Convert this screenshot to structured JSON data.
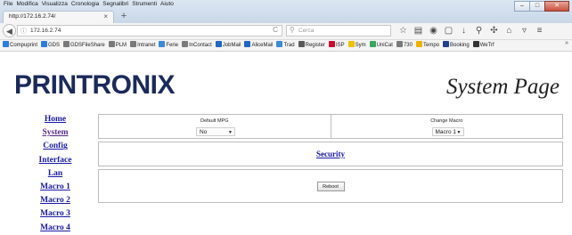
{
  "browser": {
    "menu": [
      "File",
      "Modifica",
      "Visualizza",
      "Cronologia",
      "Segnalibri",
      "Strumenti",
      "Aiuto"
    ],
    "window_controls": [
      "–",
      "□",
      "✕"
    ],
    "tab": {
      "title": "http://172.16.2.74/",
      "close": "×"
    },
    "new_tab": "+",
    "address": {
      "url": "172.16.2.74",
      "info_icon": "ⓘ",
      "reload_icon": "C"
    },
    "search": {
      "placeholder": "Cerca",
      "icon": "⚲"
    },
    "toolbar_icons": [
      {
        "name": "star-icon",
        "glyph": "☆"
      },
      {
        "name": "library-icon",
        "glyph": "▤"
      },
      {
        "name": "pocket-icon",
        "glyph": "◉"
      },
      {
        "name": "screenshot-icon",
        "glyph": "▢"
      },
      {
        "name": "download-icon",
        "glyph": "↓"
      },
      {
        "name": "addon-icon",
        "glyph": "⚲"
      },
      {
        "name": "extension-icon",
        "glyph": "✣"
      },
      {
        "name": "home-icon",
        "glyph": "⌂"
      },
      {
        "name": "shield-icon",
        "glyph": "▿"
      },
      {
        "name": "hamburger-menu-icon",
        "glyph": "≡"
      }
    ],
    "bookmarks": [
      {
        "label": "Compuprint",
        "color": "#2b7de0"
      },
      {
        "label": "GDS",
        "color": "#2b7de0"
      },
      {
        "label": "GDSFileShare",
        "color": "#7a7a7a"
      },
      {
        "label": "PLM",
        "color": "#7a7a7a"
      },
      {
        "label": "Intranet",
        "color": "#7a7a7a"
      },
      {
        "label": "Ferie",
        "color": "#3a8ad6"
      },
      {
        "label": "InContact",
        "color": "#7a7a7a"
      },
      {
        "label": "JobMail",
        "color": "#1f66c8"
      },
      {
        "label": "AliceMail",
        "color": "#1f66c8"
      },
      {
        "label": "Trad",
        "color": "#3a8ad6"
      },
      {
        "label": "Register",
        "color": "#5a5a5a"
      },
      {
        "label": "ISP",
        "color": "#c8102e"
      },
      {
        "label": "Sym",
        "color": "#f0c000"
      },
      {
        "label": "UniCat",
        "color": "#3aa65a"
      },
      {
        "label": "730",
        "color": "#7a7a7a"
      },
      {
        "label": "Tempo",
        "color": "#f0b000"
      },
      {
        "label": "Booking",
        "color": "#1f3f8f"
      },
      {
        "label": "WeTrf",
        "color": "#333333"
      }
    ],
    "bookmarks_more": "»"
  },
  "page": {
    "logo": "PRINTRONIX",
    "title": "System Page",
    "nav": [
      "Home",
      "System",
      "Config",
      "Interface",
      "Lan",
      "Macro 1",
      "Macro 2",
      "Macro 3",
      "Macro 4"
    ],
    "default_mpg": {
      "label": "Default MPG",
      "value": "No"
    },
    "change_macro": {
      "label": "Change Macro",
      "value": "Macro 1"
    },
    "security_link": "Security",
    "reboot_button": "Reboot"
  }
}
